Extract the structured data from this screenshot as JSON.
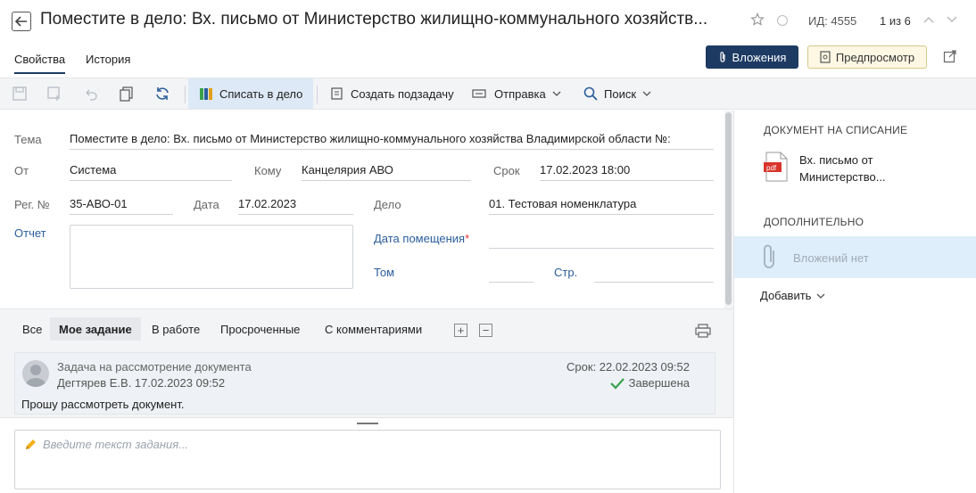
{
  "header": {
    "title": "Поместите в дело: Вх. письмо от Министерство жилищно-коммунального хозяйств...",
    "id_label": "ИД: 4555",
    "pager": "1 из 6"
  },
  "tabs": [
    {
      "label": "Свойства"
    },
    {
      "label": "История"
    }
  ],
  "header_buttons": {
    "attachments": "Вложения",
    "preview": "Предпросмотр"
  },
  "toolbar": {
    "write_off": "Списать в дело",
    "create_subtask": "Создать подзадачу",
    "send": "Отправка",
    "search": "Поиск"
  },
  "form": {
    "subject_label": "Тема",
    "subject_value": "Поместите в дело: Вх. письмо от Министерство жилищно-коммунального хозяйства Владимирской области №:",
    "from_label": "От",
    "from_value": "Система",
    "to_label": "Кому",
    "to_value": "Канцелярия АВО",
    "due_label": "Срок",
    "due_value": "17.02.2023 18:00",
    "regnum_label": "Рег. №",
    "regnum_value": "35-АВО-01",
    "date_label": "Дата",
    "date_value": "17.02.2023",
    "case_label": "Дело",
    "case_value": "01. Тестовая номенклатура",
    "report_label": "Отчет",
    "placement_date_label": "Дата помещения",
    "required_mark": "*",
    "volume_label": "Том",
    "page_label": "Стр."
  },
  "right_panel": {
    "doc_heading": "ДОКУМЕНТ НА СПИСАНИЕ",
    "doc_line1": "Вх. письмо от",
    "doc_line2": "Министерство...",
    "pdf_label": "pdf",
    "extra_heading": "ДОПОЛНИТЕЛЬНО",
    "no_attachments": "Вложений нет",
    "add_label": "Добавить"
  },
  "task_tabs": [
    {
      "label": "Все"
    },
    {
      "label": "Мое задание"
    },
    {
      "label": "В работе"
    },
    {
      "label": "Просроченные"
    },
    {
      "label": "С комментариями"
    }
  ],
  "task_controls": {
    "expand": "+",
    "collapse": "−"
  },
  "task": {
    "title": "Задача на рассмотрение документа",
    "author": "Дегтярев Е.В.  17.02.2023 09:52",
    "due": "Срок: 22.02.2023 09:52",
    "status": "Завершена",
    "body": "Прошу рассмотреть документ."
  },
  "task_input": {
    "placeholder": "Введите текст задания..."
  },
  "colors": {
    "primary": "#1d3a63",
    "link": "#2a5d9b",
    "highlight": "#dde9f6",
    "success": "#3aa24a"
  }
}
